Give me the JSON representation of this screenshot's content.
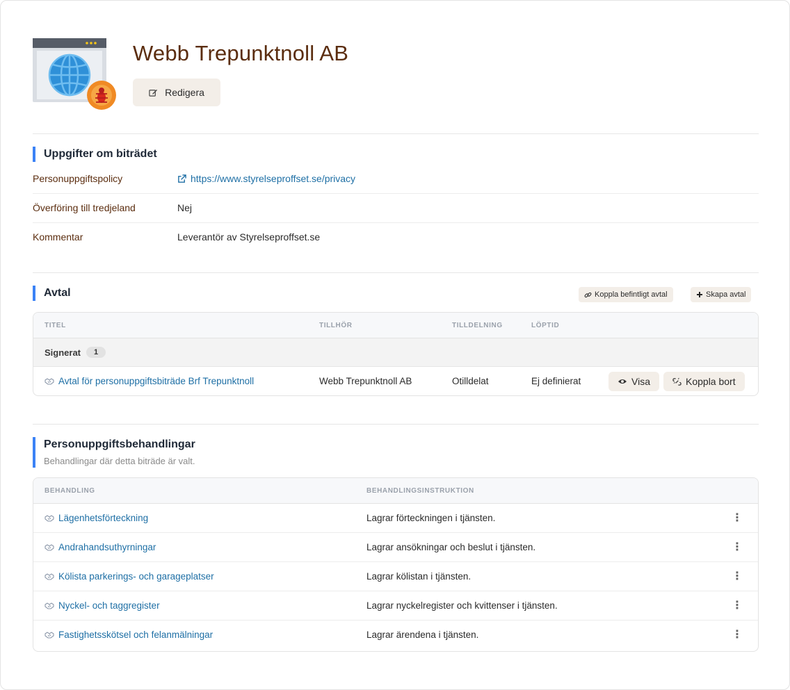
{
  "header": {
    "title": "Webb Trepunktnoll AB",
    "edit_label": "Redigera"
  },
  "details": {
    "heading": "Uppgifter om biträdet",
    "rows": [
      {
        "label": "Personuppgiftspolicy",
        "value": "https://www.styrelseproffset.se/privacy"
      },
      {
        "label": "Överföring till tredjeland",
        "value": "Nej"
      },
      {
        "label": "Kommentar",
        "value": "Leverantör av Styrelseproffset.se"
      }
    ]
  },
  "agreements": {
    "heading": "Avtal",
    "link_existing_label": "Koppla befintligt avtal",
    "create_label": "Skapa avtal",
    "columns": [
      "TITEL",
      "TILLHÖR",
      "TILLDELNING",
      "LÖPTID"
    ],
    "group": {
      "label": "Signerat",
      "count": "1"
    },
    "rows": [
      {
        "title": "Avtal för personuppgiftsbiträde Brf Trepunktnoll",
        "belongs_to": "Webb Trepunktnoll AB",
        "assignment": "Otilldelat",
        "duration": "Ej definierat",
        "view_label": "Visa",
        "unlink_label": "Koppla bort"
      }
    ]
  },
  "processing": {
    "heading": "Personuppgiftsbehandlingar",
    "subtitle": "Behandlingar där detta biträde är valt.",
    "columns": [
      "BEHANDLING",
      "BEHANDLINGSINSTRUKTION"
    ],
    "rows": [
      {
        "name": "Lägenhetsförteckning",
        "instruction": "Lagrar förteckningen i tjänsten."
      },
      {
        "name": "Andrahandsuthyrningar",
        "instruction": "Lagrar ansökningar och beslut i tjänsten."
      },
      {
        "name": "Kölista parkerings- och garageplatser",
        "instruction": "Lagrar kölistan i tjänsten."
      },
      {
        "name": "Nyckel- och taggregister",
        "instruction": "Lagrar nyckelregister och kvittenser i tjänsten."
      },
      {
        "name": "Fastighetsskötsel och felanmälningar",
        "instruction": "Lagrar ärendena i tjänsten."
      }
    ]
  },
  "colors": {
    "title_brown": "#5b2d0f",
    "link_blue": "#1e6fa5",
    "accent_blue": "#3b82f6",
    "button_bg": "#f3eee8"
  },
  "icons": {
    "logo": "browser-globe-bug-icon",
    "edit": "edit-icon",
    "external_link": "external-link-icon",
    "link": "link-icon",
    "plus": "plus-icon",
    "handshake": "handshake-icon",
    "eye": "eye-icon",
    "unlink": "unlink-icon",
    "kebab": "kebab-menu-icon"
  }
}
